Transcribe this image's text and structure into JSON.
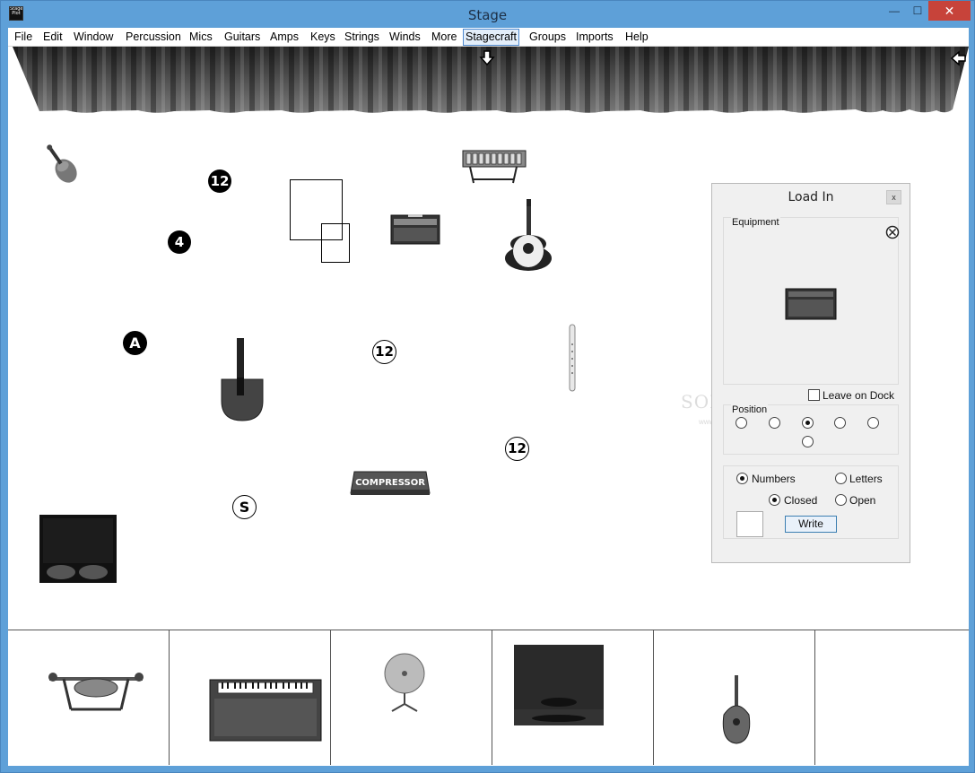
{
  "window": {
    "title": "Stage",
    "app_icon_text": "Stage Plot",
    "minimize_glyph": "—",
    "maximize_glyph": "☐",
    "close_glyph": "✕"
  },
  "menu": {
    "items": [
      "File",
      "Edit",
      "Window",
      "Percussion",
      "Mics",
      "Guitars",
      "Amps",
      "Keys",
      "Strings",
      "Winds",
      "More",
      "Stagecraft",
      "Groups",
      "Imports",
      "Help"
    ],
    "active": "Stagecraft"
  },
  "stage": {
    "markers": [
      {
        "text": "12",
        "style": "filled"
      },
      {
        "text": "4",
        "style": "filled"
      },
      {
        "text": "A",
        "style": "filled"
      },
      {
        "text": "12",
        "style": "outline"
      },
      {
        "text": "12",
        "style": "outline"
      },
      {
        "text": "S",
        "style": "outline"
      }
    ],
    "compressor_label": "COMPRESSOR"
  },
  "load_in_panel": {
    "title": "Load In",
    "close_label": "x",
    "equipment_label": "Equipment",
    "leave_on_dock_label": "Leave on Dock",
    "leave_on_dock_checked": false,
    "position_label": "Position",
    "position_selected_index": 2,
    "numbers_label": "Numbers",
    "letters_label": "Letters",
    "label_mode": "Numbers",
    "closed_label": "Closed",
    "open_label": "Open",
    "shape_mode": "Closed",
    "write_button": "Write"
  },
  "watermark": {
    "text": "SOFTPEDIA",
    "sub": "www.softpedia.com"
  },
  "colors": {
    "window_frame": "#5ea0d8",
    "close_button": "#c7433a",
    "menu_active_border": "#4f8ad0",
    "button_border": "#3c7fb1"
  }
}
